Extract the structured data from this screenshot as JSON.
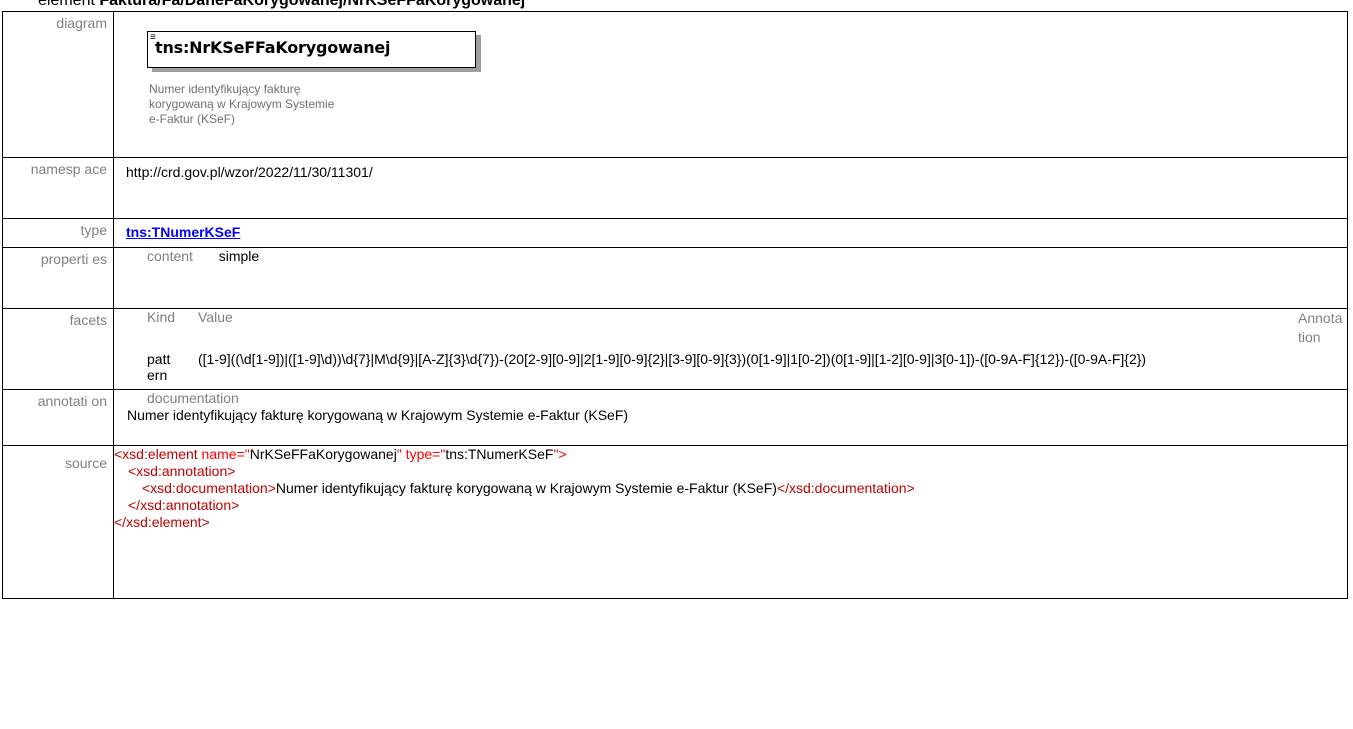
{
  "heading": {
    "prefix": "element",
    "path": "Faktura/Fa/DaneFaKorygowanej/NrKSeFFaKorygowanej"
  },
  "labels": {
    "diagram": "diagram",
    "namespace": "namesp ace",
    "type": "type",
    "properties": "properti es",
    "facets": "facets",
    "annotation": "annotati on",
    "source": "source"
  },
  "diagram": {
    "prefix": "tns:",
    "name": "NrKSeFFaKorygowanej",
    "doc_lines": [
      "Numer identyfikujący fakturę",
      "korygowaną w Krajowym Systemie",
      "e-Faktur (KSeF)"
    ]
  },
  "namespace": "http://crd.gov.pl/wzor/2022/11/30/11301/",
  "type": {
    "label": "tns:TNumerKSeF"
  },
  "properties": {
    "key": "content",
    "value": "simple"
  },
  "facets": {
    "headers": {
      "kind": "Kind",
      "value": "Value",
      "annotation": "Annota tion"
    },
    "rows": [
      {
        "kind": "patt ern",
        "value": "([1-9]((\\d[1-9])|([1-9]\\d))\\d{7}|M\\d{9}|[A-Z]{3}\\d{7})-(20[2-9][0-9]|2[1-9][0-9]{2}|[3-9][0-9]{3})(0[1-9]|1[0-2])(0[1-9]|[1-2][0-9]|3[0-1])-([0-9A-F]{12})-([0-9A-F]{2})",
        "annotation": ""
      }
    ]
  },
  "annotation": {
    "key": "documentation",
    "text": "Numer identyfikujący fakturę korygowaną w Krajowym Systemie e-Faktur (KSeF)"
  },
  "source": {
    "line1_open": "<xsd:element",
    "line1_attr1": " name",
    "line1_eq1": "=\"",
    "line1_val1": "NrKSeFFaKorygowanej",
    "line1_q1": "\"",
    "line1_attr2": " type",
    "line1_eq2": "=\"",
    "line1_val2": "tns:TNumerKSeF",
    "line1_close": "\">",
    "line2": "<xsd:annotation>",
    "line3_open": "<xsd:documentation>",
    "line3_text": "Numer identyfikujący fakturę korygowaną w Krajowym Systemie e-Faktur (KSeF)",
    "line3_close": "</xsd:documentation>",
    "line4": "</xsd:annotation>",
    "line5": "</xsd:element>"
  }
}
